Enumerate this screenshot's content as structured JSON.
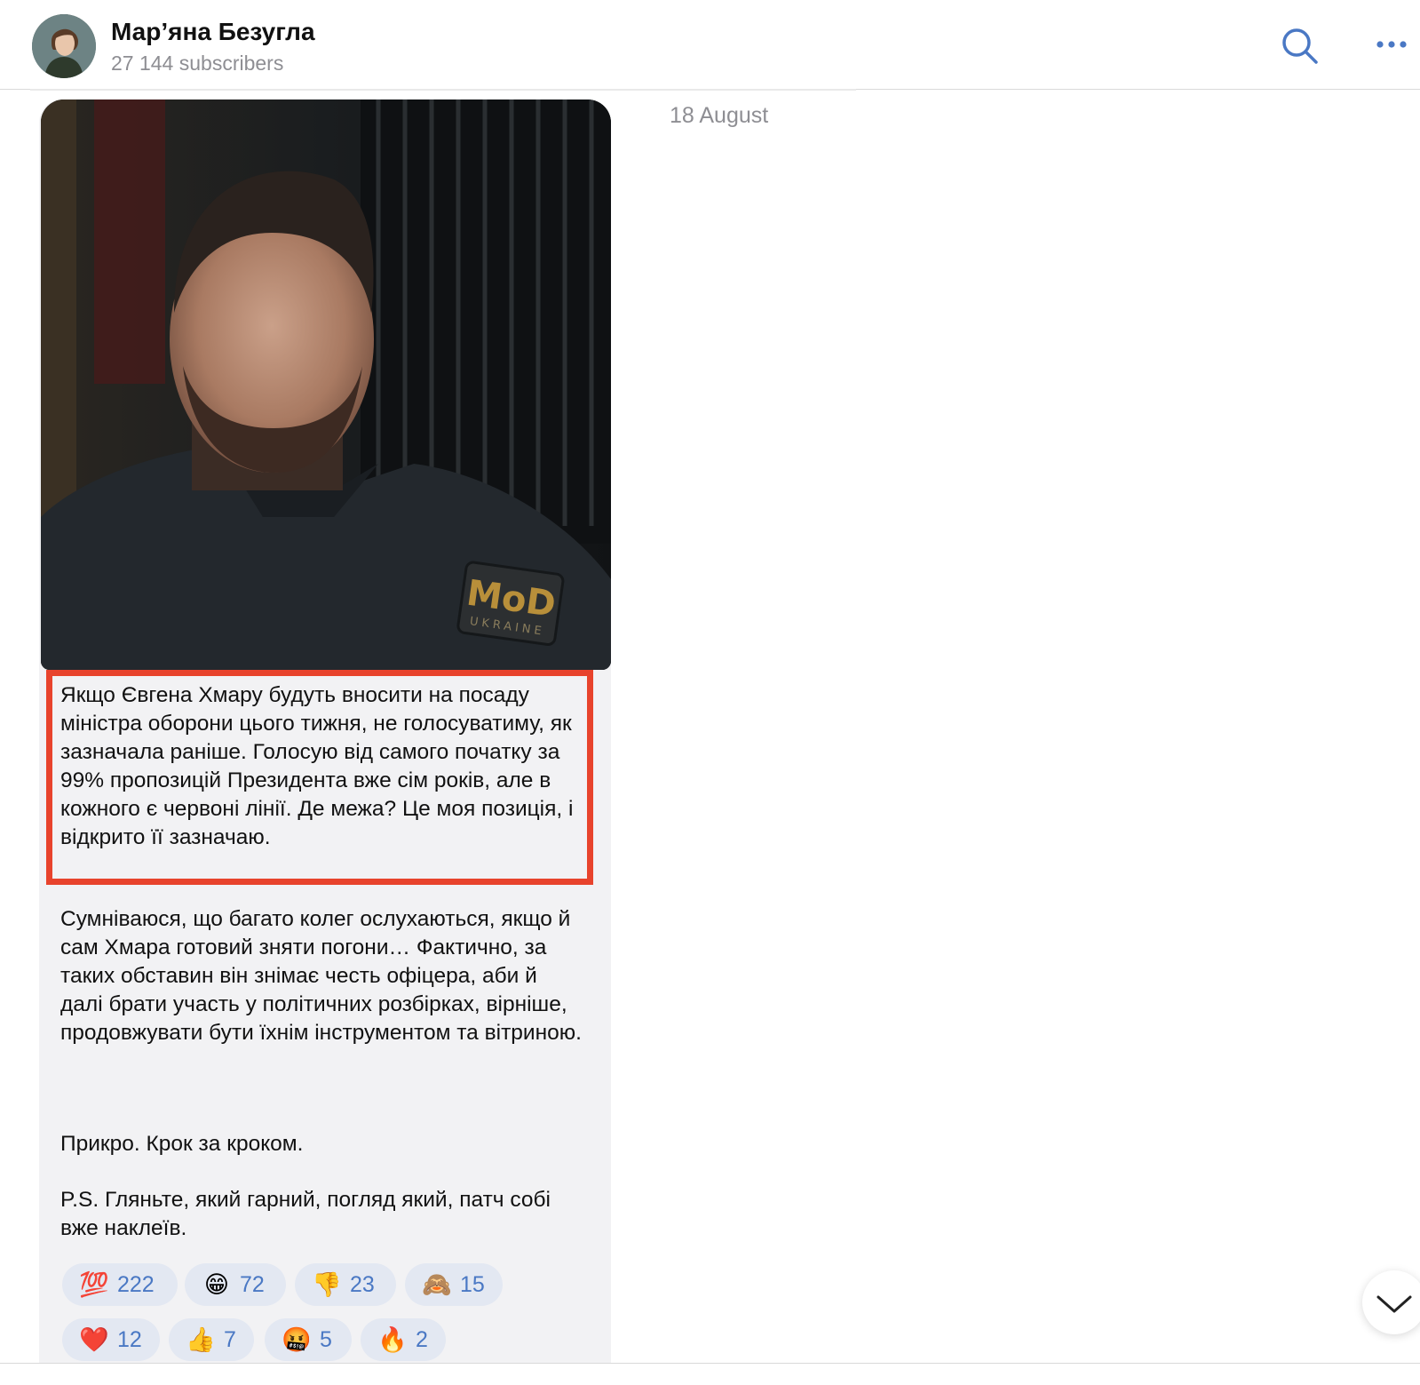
{
  "header": {
    "channel_name": "Мар’яна Безугла",
    "subscribers": "27 144 subscribers",
    "search_icon": "search-icon",
    "more_icon": "more-horizontal-icon"
  },
  "message": {
    "date": "18 August",
    "photo_patch_text": "MoD",
    "photo_patch_subtext": "UKRAINE",
    "highlighted_text": "Якщо Євгена Хмару будуть вносити на посаду міністра оборони цього тижня, не голосуватиму, як зазначала раніше. Голосую від самого початку за 99% пропозицій Президента вже сім років, але в кожного є червоні лінії. Де межа? Це моя позиція, і відкрито її зазначаю.",
    "paragraph_1": "Сумніваюся, що багато колег ослухаються, якщо й сам Хмара готовий зняти погони… Фактично, за таких обставин він знімає честь офіцера, аби й далі брати участь у політичних розбірках, вірніше, продовжувати бути їхнім інструментом та вітриною.",
    "paragraph_2": "Прикро. Крок за кроком.",
    "paragraph_3": "P.S. Гляньте, який гарний, погляд який, патч собі вже наклеїв.",
    "reactions": [
      {
        "emoji": "💯",
        "count": "222",
        "icon": "hundred-points-icon"
      },
      {
        "emoji": "😁",
        "count": "72",
        "icon": "grinning-face-icon"
      },
      {
        "emoji": "👎",
        "count": "23",
        "icon": "thumbs-down-icon"
      },
      {
        "emoji": "🙈",
        "count": "15",
        "icon": "see-no-evil-monkey-icon"
      },
      {
        "emoji": "❤️",
        "count": "12",
        "icon": "red-heart-icon"
      },
      {
        "emoji": "👍",
        "count": "7",
        "icon": "thumbs-up-icon"
      },
      {
        "emoji": "🤬",
        "count": "5",
        "icon": "cursing-face-icon"
      },
      {
        "emoji": "🔥",
        "count": "2",
        "icon": "fire-icon"
      }
    ]
  },
  "colors": {
    "accent": "#4a78c4",
    "highlight_border": "#e8432c",
    "bubble": "#f2f2f4",
    "reaction_bg": "#e3e8f2",
    "muted_text": "#8e8e93"
  }
}
